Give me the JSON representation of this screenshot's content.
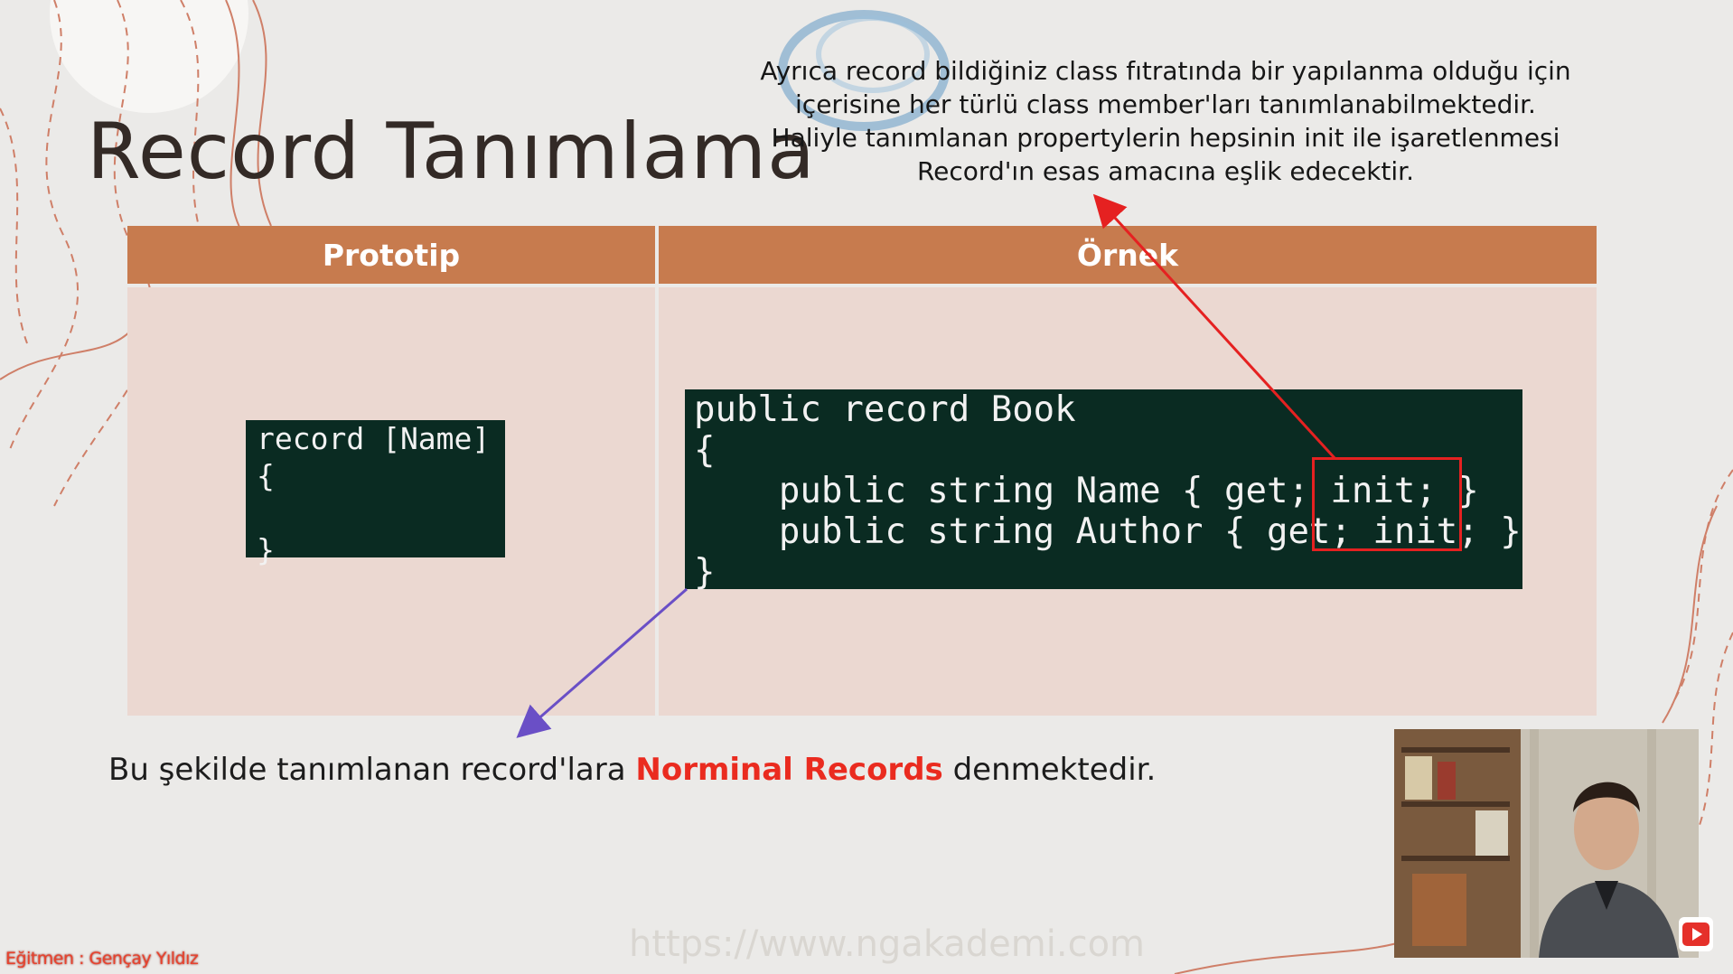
{
  "slide": {
    "title": "Record Tanımlama",
    "note_lines": [
      "Ayrıca record bildiğiniz class fıtratında bir yapılanma olduğu için",
      "içerisine her türlü class member'ları tanımlanabilmektedir.",
      "Haliyle tanımlanan propertylerin hepsinin init ile işaretlenmesi",
      "Record'ın esas amacına eşlik edecektir."
    ],
    "table": {
      "headers": [
        "Prototip",
        "Örnek"
      ],
      "prototype_code": "record [Name]\n{\n\n}",
      "example_code": "public record Book\n{\n    public string Name { get; init; }\n    public string Author { get; init; }\n}"
    },
    "bottom_text": {
      "before": "Bu şekilde tanımlanan record'lara ",
      "highlight": "Norminal Records",
      "after": " denmektedir."
    },
    "watermark": "https://www.ngakademi.com",
    "instructor": "Eğitmen : Gençay Yıldız"
  },
  "colors": {
    "header_bg": "#c77b4e",
    "cell_bg": "#ebd8d1",
    "code_bg": "#0a2b22",
    "highlight": "#ea2b1f",
    "arrow_red": "#e52121",
    "arrow_purple": "#6a4fc6"
  },
  "icons": [
    "ngakademi-logo",
    "youtube-icon",
    "webcam-feed"
  ]
}
